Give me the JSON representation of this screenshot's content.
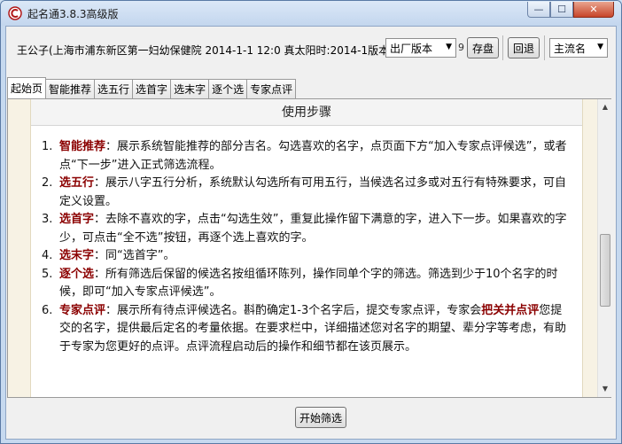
{
  "window": {
    "title": "起名通3.8.3高级版",
    "controls": {
      "minimize": "—",
      "maximize": "☐",
      "close": "✕"
    }
  },
  "toolbar": {
    "info": "王公子(上海市浦东新区第一妇幼保健院 2014-1-1 12:0 真太阳时:2014-1版本:",
    "trail": "9",
    "version_select": "出厂版本",
    "save_label": "存盘",
    "back_label": "回退",
    "mode_select": "主流名"
  },
  "tabs": [
    {
      "label": "起始页",
      "active": true
    },
    {
      "label": "智能推荐"
    },
    {
      "label": "选五行"
    },
    {
      "label": "选首字"
    },
    {
      "label": "选末字"
    },
    {
      "label": "逐个选"
    },
    {
      "label": "专家点评"
    }
  ],
  "content": {
    "header": "使用步骤",
    "steps": [
      {
        "num": "1.",
        "kw": "智能推荐",
        "text": "：展示系统智能推荐的部分吉名。勾选喜欢的名字，点页面下方“加入专家点评候选”，或者点“下一步”进入正式筛选流程。"
      },
      {
        "num": "2.",
        "kw": "选五行",
        "text": "：展示八字五行分析，系统默认勾选所有可用五行，当候选名过多或对五行有特殊要求，可自定义设置。"
      },
      {
        "num": "3.",
        "kw": "选首字",
        "text": "：去除不喜欢的字，点击“勾选生效”，重复此操作留下满意的字，进入下一步。如果喜欢的字少，可点击“全不选”按钮，再逐个选上喜欢的字。"
      },
      {
        "num": "4.",
        "kw": "选末字",
        "text": "：同“选首字”。"
      },
      {
        "num": "5.",
        "kw": "逐个选",
        "text": "：所有筛选后保留的候选名按组循环陈列，操作同单个字的筛选。筛选到少于10个名字的时候，即可“加入专家点评候选”。"
      },
      {
        "num": "6.",
        "kw": "专家点评",
        "text": "：展示所有待点评候选名。斟酌确定1-3个名字后，提交专家点评，专家会",
        "kw2": "把关并点评",
        "text2": "您提交的名字，提供最后定名的考量依据。在要求栏中，详细描述您对名字的期望、辈分字等考虑，有助于专家为您更好的点评。点评流程启动后的操作和细节都在该页展示。"
      }
    ]
  },
  "footer": {
    "start_label": "开始筛选"
  },
  "colors": {
    "keyword": "#8b0000",
    "titlebar": "#c6d9ef"
  }
}
